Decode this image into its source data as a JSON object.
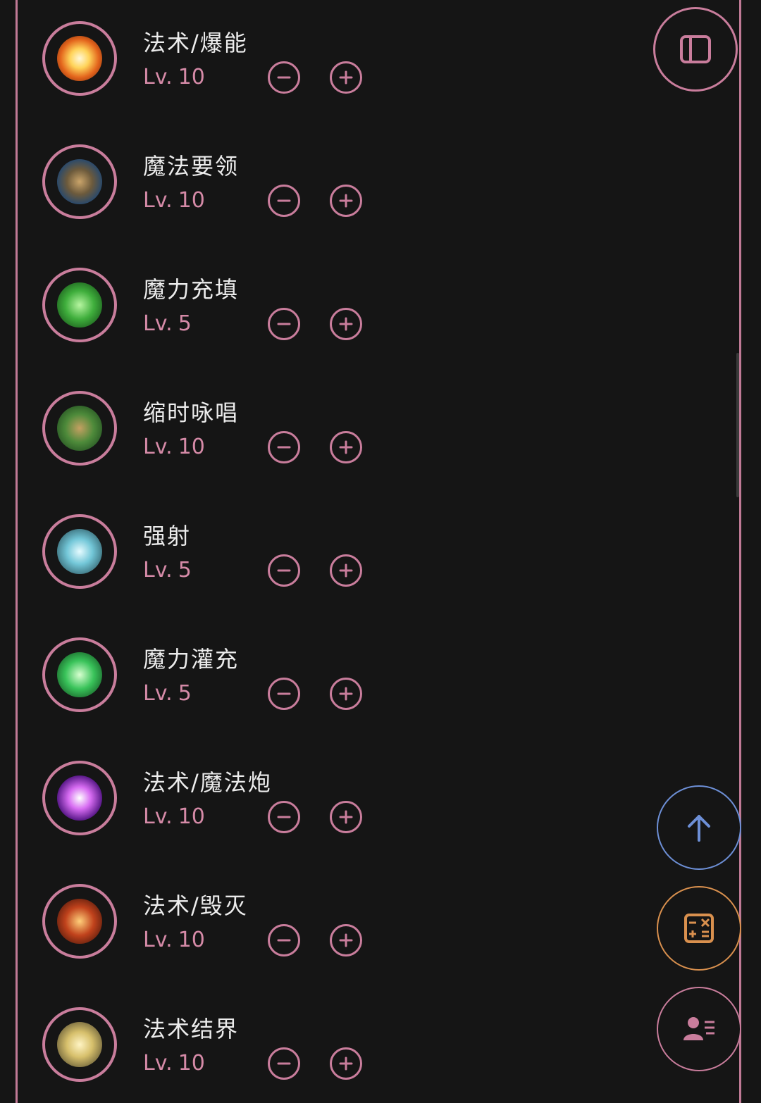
{
  "skills": [
    {
      "name": "法术/爆能",
      "level_prefix": "Lv.",
      "level": "10",
      "icon": "burst-spell-icon"
    },
    {
      "name": "魔法要领",
      "level_prefix": "Lv.",
      "level": "10",
      "icon": "magic-essentials-icon"
    },
    {
      "name": "魔力充填",
      "level_prefix": "Lv.",
      "level": "5",
      "icon": "mana-charge-icon"
    },
    {
      "name": "缩时咏唱",
      "level_prefix": "Lv.",
      "level": "10",
      "icon": "quick-chant-icon"
    },
    {
      "name": "强射",
      "level_prefix": "Lv.",
      "level": "5",
      "icon": "power-shot-icon"
    },
    {
      "name": "魔力灌充",
      "level_prefix": "Lv.",
      "level": "5",
      "icon": "mana-infusion-icon"
    },
    {
      "name": "法术/魔法炮",
      "level_prefix": "Lv.",
      "level": "10",
      "icon": "magic-cannon-icon"
    },
    {
      "name": "法术/毁灭",
      "level_prefix": "Lv.",
      "level": "10",
      "icon": "destruction-spell-icon"
    },
    {
      "name": "法术结界",
      "level_prefix": "Lv.",
      "level": "10",
      "icon": "spell-barrier-icon"
    }
  ],
  "controls": {
    "decrease_icon": "minus-circle-icon",
    "increase_icon": "plus-circle-icon"
  },
  "fabs": {
    "sidebar_toggle_icon": "sidebar-panel-icon",
    "scroll_top_icon": "arrow-up-icon",
    "calculator_icon": "calculator-icon",
    "character_icon": "user-list-icon"
  },
  "colors": {
    "background": "#151515",
    "accent_pink": "#c97d9c",
    "level_text": "#d58aa7",
    "fab_blue": "#6d8fd6",
    "fab_orange": "#d9904e"
  }
}
